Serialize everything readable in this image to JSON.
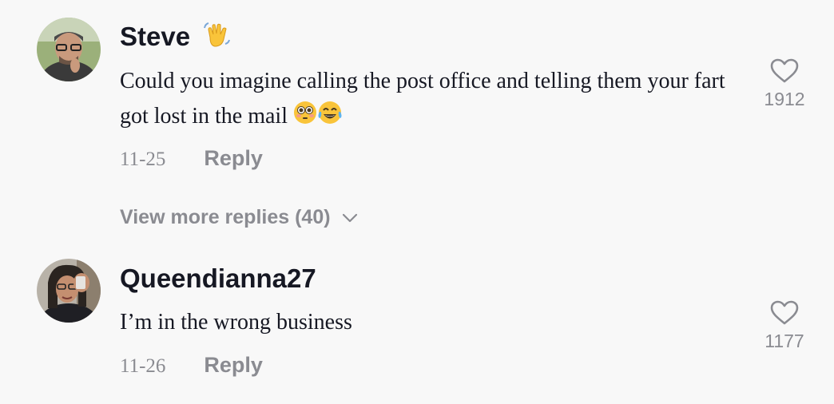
{
  "comments": [
    {
      "username": "Steve",
      "username_emoji": "waving-hand-emoji",
      "text": "Could you imagine calling the post office and telling them your fart got lost in the mail",
      "text_emojis": [
        "flushed-face-emoji",
        "tears-of-joy-emoji"
      ],
      "date": "11-25",
      "reply_label": "Reply",
      "like_icon": "heart-outline-icon",
      "like_count": "1912"
    },
    {
      "username": "Queendianna27",
      "text": "I’m in the wrong business",
      "date": "11-26",
      "reply_label": "Reply",
      "like_icon": "heart-outline-icon",
      "like_count": "1177"
    }
  ],
  "view_more_replies": {
    "label": "View more replies (40)",
    "icon": "chevron-down-icon"
  },
  "colors": {
    "background": "#f8f8f8",
    "primary_text": "#161823",
    "secondary_text": "#8a8b91"
  }
}
